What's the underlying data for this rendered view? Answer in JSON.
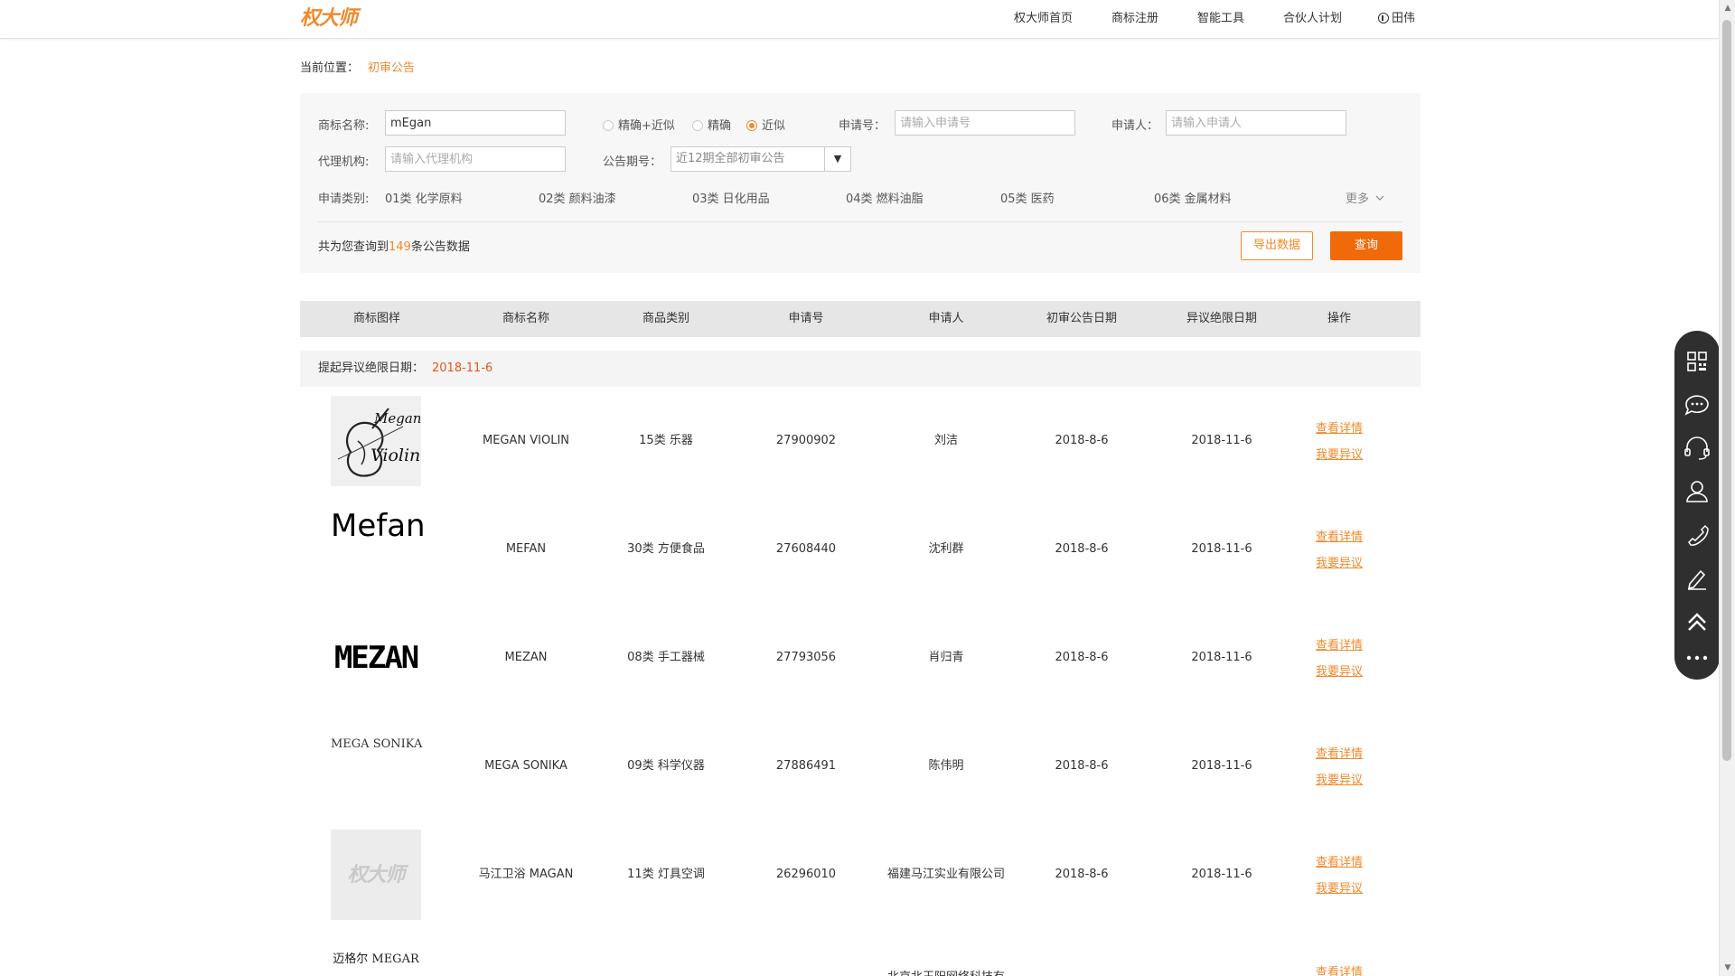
{
  "header": {
    "logo": "权大师",
    "nav": [
      "权大师首页",
      "商标注册",
      "智能工具",
      "合伙人计划"
    ],
    "user": "田伟"
  },
  "breadcrumb": {
    "label": "当前位置：",
    "current": "初审公告"
  },
  "filters": {
    "name_label": "商标名称:",
    "name_value": "mEgan",
    "match_modes": [
      "精确+近似",
      "精确",
      "近似"
    ],
    "match_selected": "近似",
    "app_no_label": "申请号：",
    "app_no_placeholder": "请输入申请号",
    "applicant_label": "申请人：",
    "applicant_placeholder": "请输入申请人",
    "agency_label": "代理机构:",
    "agency_placeholder": "请输入代理机构",
    "issue_label": "公告期号：",
    "issue_value": "近12期全部初审公告",
    "class_label": "申请类别:",
    "classes": [
      "01类 化学原料",
      "02类 颜料油漆",
      "03类 日化用品",
      "04类 燃料油脂",
      "05类 医药",
      "06类 金属材料"
    ],
    "more": "更多"
  },
  "result": {
    "prefix": "共为您查询到",
    "count": "149",
    "suffix": "条公告数据"
  },
  "buttons": {
    "export": "导出数据",
    "query": "查询"
  },
  "table": {
    "headers": [
      "商标图样",
      "商标名称",
      "商品类别",
      "申请号",
      "申请人",
      "初审公告日期",
      "异议绝限日期",
      "操作"
    ],
    "deadline_label": "提起异议绝限日期：",
    "deadline_value": "2018-11-6",
    "op_detail": "查看详情",
    "op_object": "我要异议",
    "rows": [
      {
        "mark": "Megan Violin",
        "name": "MEGAN VIOLIN",
        "category": "15类 乐器",
        "app_no": "27900902",
        "applicant": "刘洁",
        "pub_date": "2018-8-6",
        "deadline": "2018-11-6"
      },
      {
        "mark": "Mefan",
        "name": "MEFAN",
        "category": "30类 方便食品",
        "app_no": "27608440",
        "applicant": "沈利群",
        "pub_date": "2018-8-6",
        "deadline": "2018-11-6"
      },
      {
        "mark": "MEZAN",
        "name": "MEZAN",
        "category": "08类 手工器械",
        "app_no": "27793056",
        "applicant": "肖归青",
        "pub_date": "2018-8-6",
        "deadline": "2018-11-6"
      },
      {
        "mark": "MEGA SONIKA",
        "name": "MEGA SONIKA",
        "category": "09类 科学仪器",
        "app_no": "27886491",
        "applicant": "陈伟明",
        "pub_date": "2018-8-6",
        "deadline": "2018-11-6"
      },
      {
        "mark": "权大师",
        "name": "马江卫浴 MAGAN",
        "category": "11类 灯具空调",
        "app_no": "26296010",
        "applicant": "福建马江实业有限公司",
        "pub_date": "2018-8-6",
        "deadline": "2018-11-6"
      },
      {
        "mark": "迈格尔 MEGAR",
        "name": "",
        "category": "",
        "app_no": "",
        "applicant": "北京北玉阳网络科技有",
        "pub_date": "",
        "deadline": ""
      }
    ]
  },
  "sidebar_icons": [
    "qrcode-icon",
    "chat-icon",
    "headset-icon",
    "user-icon",
    "phone-icon",
    "edit-icon",
    "back-to-top-icon",
    "more-icon"
  ]
}
